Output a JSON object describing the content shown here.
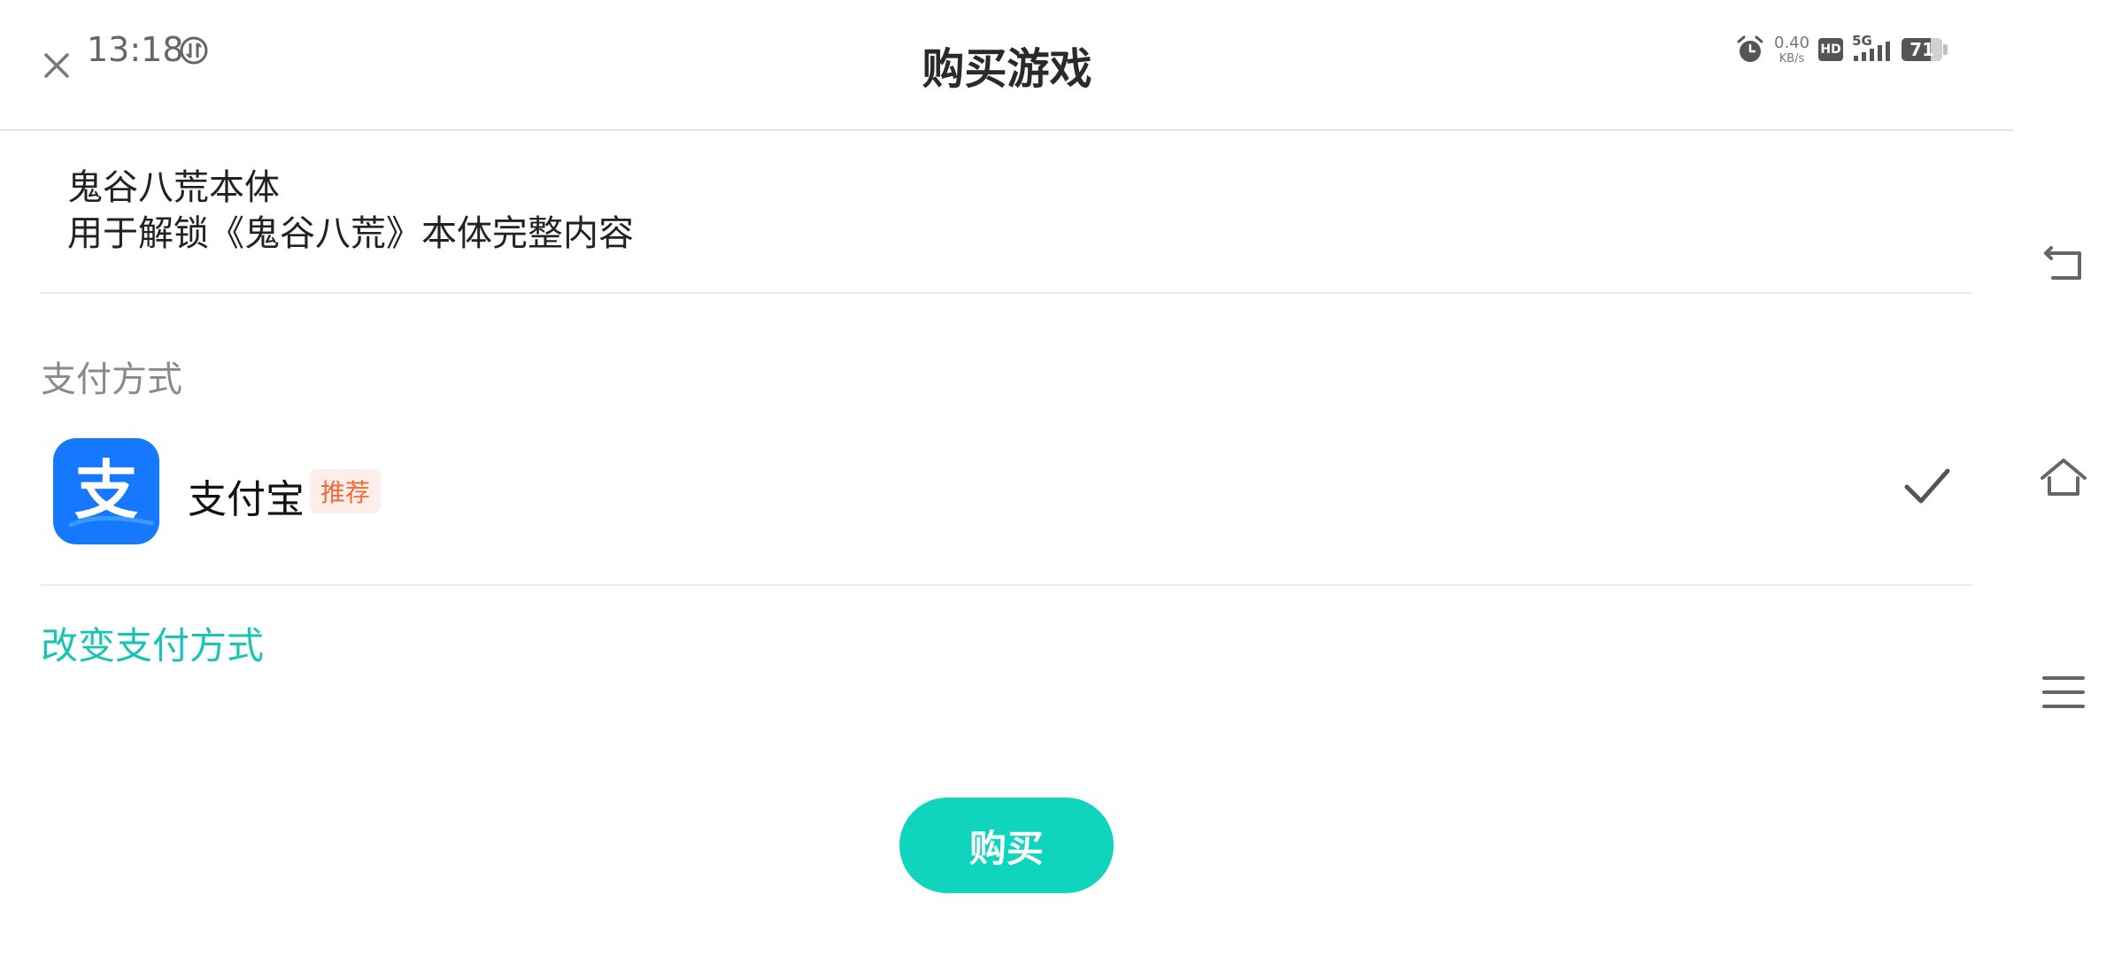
{
  "header": {
    "title": "购买游戏",
    "close_icon": "close-icon"
  },
  "status_bar": {
    "time": "13:18",
    "net_speed_value": "0.40",
    "net_speed_unit": "KB/s",
    "hd_label": "HD",
    "network_label": "5G",
    "battery_level": "71",
    "battery_fraction": 0.71
  },
  "product": {
    "name": "鬼谷八荒本体",
    "description": "用于解锁《鬼谷八荒》本体完整内容"
  },
  "payment": {
    "section_label": "支付方式",
    "method_name": "支付宝",
    "method_badge": "推荐",
    "method_icon_char": "支",
    "selected": true,
    "change_link": "改变支付方式"
  },
  "actions": {
    "buy_label": "购买"
  },
  "colors": {
    "accent": "#0fd4be",
    "link": "#17c5b4",
    "alipay_blue": "#1677ff",
    "badge_text": "#ef6b3c",
    "badge_bg": "#fdeeea"
  },
  "side_nav": {
    "icons": [
      "back-icon",
      "home-icon",
      "menu-icon"
    ]
  }
}
